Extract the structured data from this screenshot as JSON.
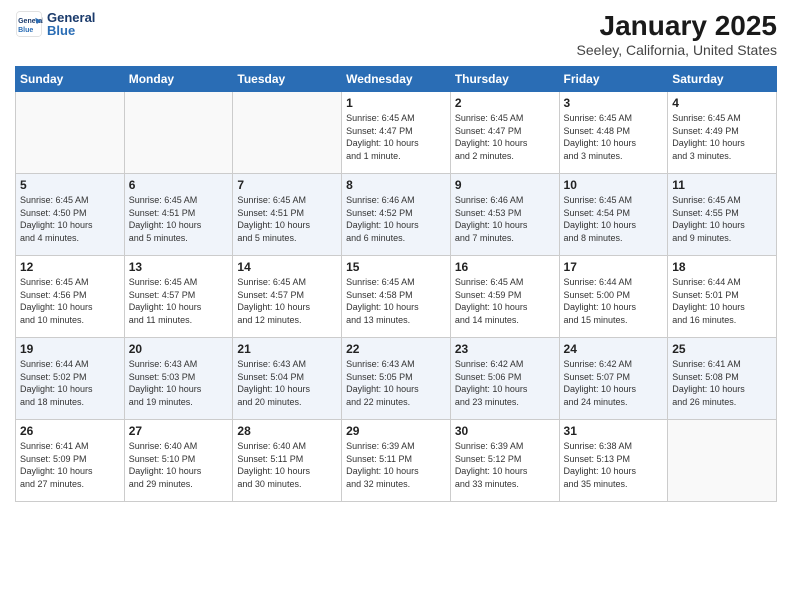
{
  "header": {
    "logo_line1": "General",
    "logo_line2": "Blue",
    "month": "January 2025",
    "location": "Seeley, California, United States"
  },
  "days_of_week": [
    "Sunday",
    "Monday",
    "Tuesday",
    "Wednesday",
    "Thursday",
    "Friday",
    "Saturday"
  ],
  "weeks": [
    [
      {
        "day": "",
        "info": ""
      },
      {
        "day": "",
        "info": ""
      },
      {
        "day": "",
        "info": ""
      },
      {
        "day": "1",
        "info": "Sunrise: 6:45 AM\nSunset: 4:47 PM\nDaylight: 10 hours\nand 1 minute."
      },
      {
        "day": "2",
        "info": "Sunrise: 6:45 AM\nSunset: 4:47 PM\nDaylight: 10 hours\nand 2 minutes."
      },
      {
        "day": "3",
        "info": "Sunrise: 6:45 AM\nSunset: 4:48 PM\nDaylight: 10 hours\nand 3 minutes."
      },
      {
        "day": "4",
        "info": "Sunrise: 6:45 AM\nSunset: 4:49 PM\nDaylight: 10 hours\nand 3 minutes."
      }
    ],
    [
      {
        "day": "5",
        "info": "Sunrise: 6:45 AM\nSunset: 4:50 PM\nDaylight: 10 hours\nand 4 minutes."
      },
      {
        "day": "6",
        "info": "Sunrise: 6:45 AM\nSunset: 4:51 PM\nDaylight: 10 hours\nand 5 minutes."
      },
      {
        "day": "7",
        "info": "Sunrise: 6:45 AM\nSunset: 4:51 PM\nDaylight: 10 hours\nand 5 minutes."
      },
      {
        "day": "8",
        "info": "Sunrise: 6:46 AM\nSunset: 4:52 PM\nDaylight: 10 hours\nand 6 minutes."
      },
      {
        "day": "9",
        "info": "Sunrise: 6:46 AM\nSunset: 4:53 PM\nDaylight: 10 hours\nand 7 minutes."
      },
      {
        "day": "10",
        "info": "Sunrise: 6:45 AM\nSunset: 4:54 PM\nDaylight: 10 hours\nand 8 minutes."
      },
      {
        "day": "11",
        "info": "Sunrise: 6:45 AM\nSunset: 4:55 PM\nDaylight: 10 hours\nand 9 minutes."
      }
    ],
    [
      {
        "day": "12",
        "info": "Sunrise: 6:45 AM\nSunset: 4:56 PM\nDaylight: 10 hours\nand 10 minutes."
      },
      {
        "day": "13",
        "info": "Sunrise: 6:45 AM\nSunset: 4:57 PM\nDaylight: 10 hours\nand 11 minutes."
      },
      {
        "day": "14",
        "info": "Sunrise: 6:45 AM\nSunset: 4:57 PM\nDaylight: 10 hours\nand 12 minutes."
      },
      {
        "day": "15",
        "info": "Sunrise: 6:45 AM\nSunset: 4:58 PM\nDaylight: 10 hours\nand 13 minutes."
      },
      {
        "day": "16",
        "info": "Sunrise: 6:45 AM\nSunset: 4:59 PM\nDaylight: 10 hours\nand 14 minutes."
      },
      {
        "day": "17",
        "info": "Sunrise: 6:44 AM\nSunset: 5:00 PM\nDaylight: 10 hours\nand 15 minutes."
      },
      {
        "day": "18",
        "info": "Sunrise: 6:44 AM\nSunset: 5:01 PM\nDaylight: 10 hours\nand 16 minutes."
      }
    ],
    [
      {
        "day": "19",
        "info": "Sunrise: 6:44 AM\nSunset: 5:02 PM\nDaylight: 10 hours\nand 18 minutes."
      },
      {
        "day": "20",
        "info": "Sunrise: 6:43 AM\nSunset: 5:03 PM\nDaylight: 10 hours\nand 19 minutes."
      },
      {
        "day": "21",
        "info": "Sunrise: 6:43 AM\nSunset: 5:04 PM\nDaylight: 10 hours\nand 20 minutes."
      },
      {
        "day": "22",
        "info": "Sunrise: 6:43 AM\nSunset: 5:05 PM\nDaylight: 10 hours\nand 22 minutes."
      },
      {
        "day": "23",
        "info": "Sunrise: 6:42 AM\nSunset: 5:06 PM\nDaylight: 10 hours\nand 23 minutes."
      },
      {
        "day": "24",
        "info": "Sunrise: 6:42 AM\nSunset: 5:07 PM\nDaylight: 10 hours\nand 24 minutes."
      },
      {
        "day": "25",
        "info": "Sunrise: 6:41 AM\nSunset: 5:08 PM\nDaylight: 10 hours\nand 26 minutes."
      }
    ],
    [
      {
        "day": "26",
        "info": "Sunrise: 6:41 AM\nSunset: 5:09 PM\nDaylight: 10 hours\nand 27 minutes."
      },
      {
        "day": "27",
        "info": "Sunrise: 6:40 AM\nSunset: 5:10 PM\nDaylight: 10 hours\nand 29 minutes."
      },
      {
        "day": "28",
        "info": "Sunrise: 6:40 AM\nSunset: 5:11 PM\nDaylight: 10 hours\nand 30 minutes."
      },
      {
        "day": "29",
        "info": "Sunrise: 6:39 AM\nSunset: 5:11 PM\nDaylight: 10 hours\nand 32 minutes."
      },
      {
        "day": "30",
        "info": "Sunrise: 6:39 AM\nSunset: 5:12 PM\nDaylight: 10 hours\nand 33 minutes."
      },
      {
        "day": "31",
        "info": "Sunrise: 6:38 AM\nSunset: 5:13 PM\nDaylight: 10 hours\nand 35 minutes."
      },
      {
        "day": "",
        "info": ""
      }
    ]
  ]
}
